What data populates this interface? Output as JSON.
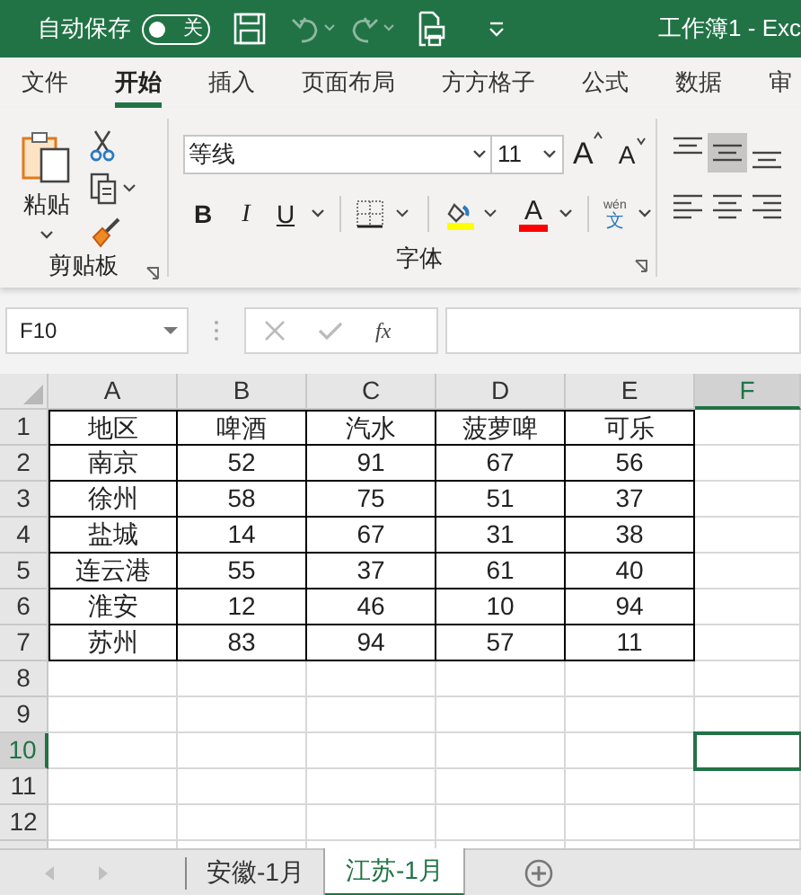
{
  "title_bar": {
    "autosave_label": "自动保存",
    "autosave_toggle": {
      "on": false,
      "label": "关"
    },
    "title": "工作簿1  -  Exc"
  },
  "menu_tabs": [
    {
      "label": "文件",
      "selected": false
    },
    {
      "label": "开始",
      "selected": true
    },
    {
      "label": "插入",
      "selected": false
    },
    {
      "label": "页面布局",
      "selected": false
    },
    {
      "label": "方方格子",
      "selected": false
    },
    {
      "label": "公式",
      "selected": false
    },
    {
      "label": "数据",
      "selected": false
    },
    {
      "label": "审",
      "selected": false
    }
  ],
  "ribbon": {
    "clipboard": {
      "paste_label": "粘贴",
      "group_label": "剪贴板"
    },
    "font": {
      "font_name": "等线",
      "font_size": "11",
      "grow_font": "A",
      "shrink_font": "A",
      "bold": "B",
      "italic": "I",
      "underline": "U",
      "font_color_letter": "A",
      "phonetic_top": "wén",
      "phonetic_bottom": "文",
      "group_label": "字体"
    },
    "alignment": [
      {
        "kind": "top",
        "selected": false
      },
      {
        "kind": "middle",
        "selected": true
      },
      {
        "kind": "bottom",
        "selected": false
      },
      {
        "kind": "left",
        "selected": false
      },
      {
        "kind": "center",
        "selected": false
      },
      {
        "kind": "right",
        "selected": false
      }
    ]
  },
  "formula_bar": {
    "name_box": "F10",
    "fx": "fx"
  },
  "sheet": {
    "columns": [
      {
        "label": "A",
        "selected": false
      },
      {
        "label": "B",
        "selected": false
      },
      {
        "label": "C",
        "selected": false
      },
      {
        "label": "D",
        "selected": false
      },
      {
        "label": "E",
        "selected": false
      },
      {
        "label": "F",
        "selected": true
      }
    ],
    "rows": [
      {
        "header": "1",
        "selected": false,
        "cells": [
          "地区",
          "啤酒",
          "汽水",
          "菠萝啤",
          "可乐"
        ]
      },
      {
        "header": "2",
        "selected": false,
        "cells": [
          "南京",
          "52",
          "91",
          "67",
          "56"
        ]
      },
      {
        "header": "3",
        "selected": false,
        "cells": [
          "徐州",
          "58",
          "75",
          "51",
          "37"
        ]
      },
      {
        "header": "4",
        "selected": false,
        "cells": [
          "盐城",
          "14",
          "67",
          "31",
          "38"
        ]
      },
      {
        "header": "5",
        "selected": false,
        "cells": [
          "连云港",
          "55",
          "37",
          "61",
          "40"
        ]
      },
      {
        "header": "6",
        "selected": false,
        "cells": [
          "淮安",
          "12",
          "46",
          "10",
          "94"
        ]
      },
      {
        "header": "7",
        "selected": false,
        "cells": [
          "苏州",
          "83",
          "94",
          "57",
          "11"
        ]
      },
      {
        "header": "8",
        "selected": false,
        "cells": []
      },
      {
        "header": "9",
        "selected": false,
        "cells": []
      },
      {
        "header": "10",
        "selected": true,
        "cells": []
      },
      {
        "header": "11",
        "selected": false,
        "cells": []
      },
      {
        "header": "12",
        "selected": false,
        "cells": []
      }
    ]
  },
  "sheet_tabs": [
    {
      "label": "安徽-1月",
      "selected": false
    },
    {
      "label": "江苏-1月",
      "selected": true
    }
  ]
}
